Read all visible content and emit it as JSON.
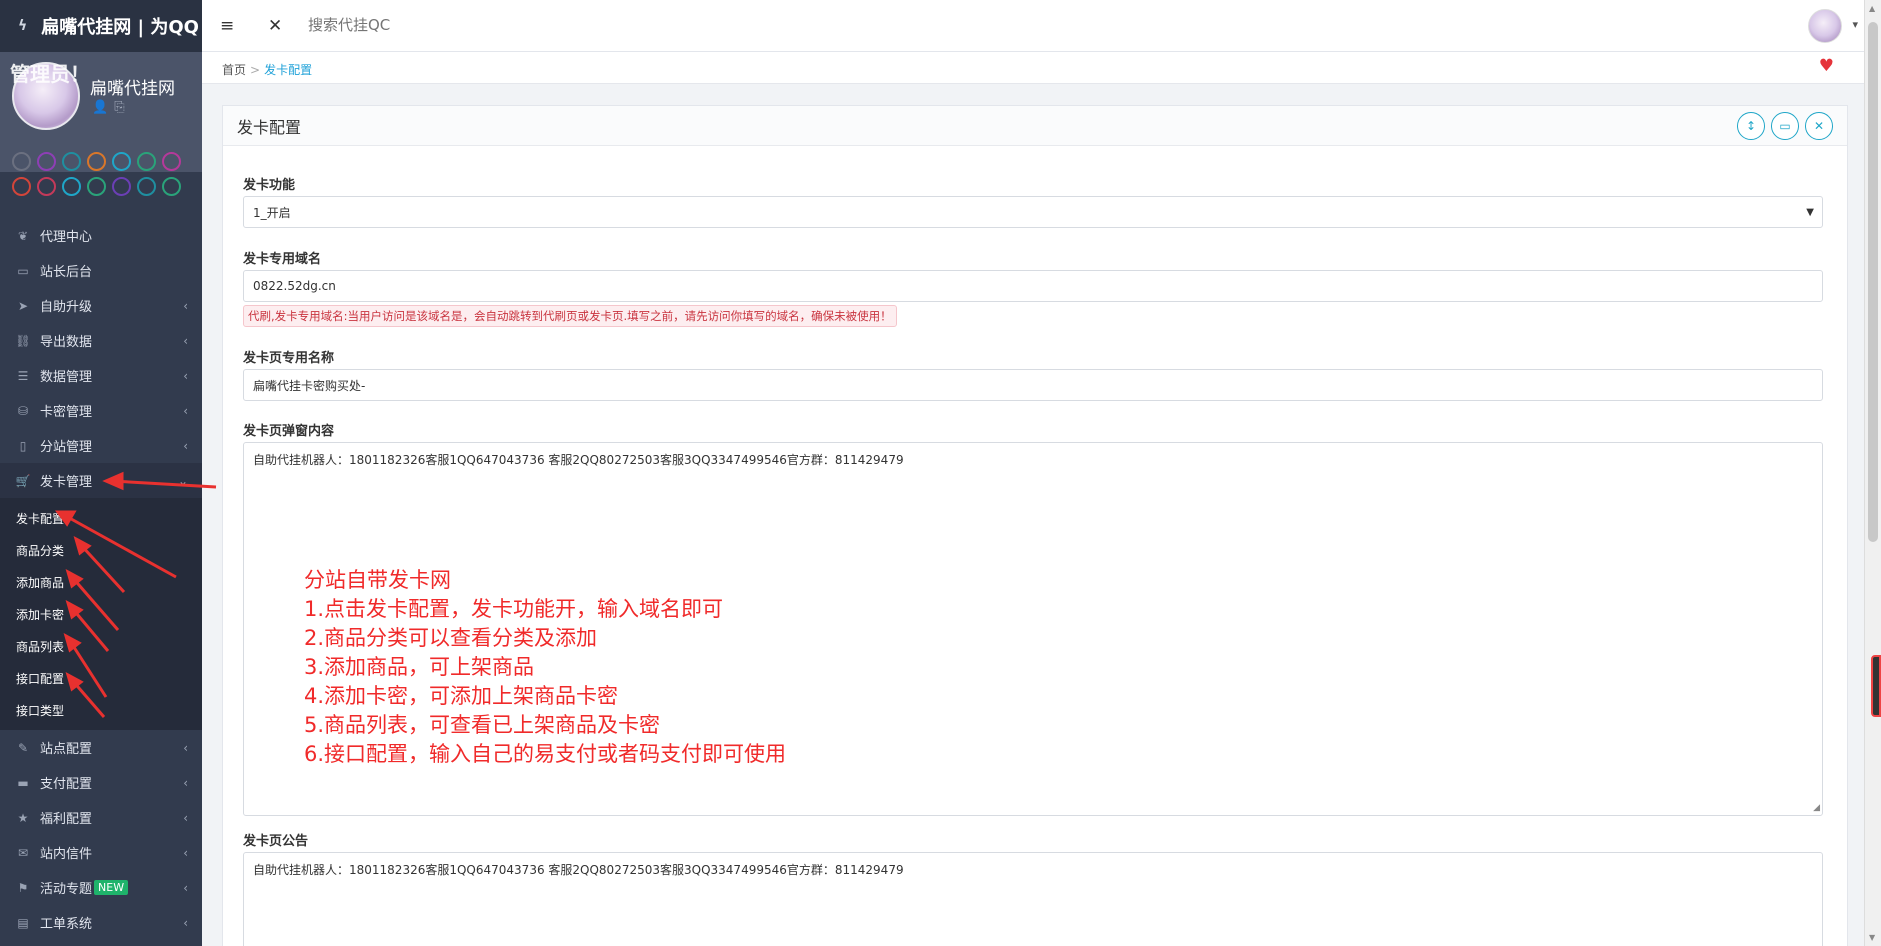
{
  "brand": {
    "title": "扁嘴代挂网 | 为QQ"
  },
  "profile": {
    "name": "扁嘴代挂网",
    "overlay_text": "管理员！"
  },
  "swatch_colors": [
    "#6b7080",
    "#8e3fb5",
    "#1f8fa0",
    "#d9772a",
    "#1fa6c8",
    "#2aa37a",
    "#b5399a",
    "#d2453a",
    "#c43a5a",
    "#1fa6c8",
    "#2aa37a",
    "#6b3fb5",
    "#1f8fa0",
    "#2aa37a"
  ],
  "nav": {
    "items": [
      {
        "label": "代理中心",
        "icon": "leaf-icon"
      },
      {
        "label": "站长后台",
        "icon": "laptop-icon"
      },
      {
        "label": "自助升级",
        "icon": "send-icon"
      },
      {
        "label": "导出数据",
        "icon": "share-icon"
      },
      {
        "label": "数据管理",
        "icon": "list-icon"
      },
      {
        "label": "卡密管理",
        "icon": "database-icon"
      },
      {
        "label": "分站管理",
        "icon": "mobile-icon"
      },
      {
        "label": "发卡管理",
        "icon": "cart-icon"
      }
    ],
    "sub_items": [
      "发卡配置",
      "商品分类",
      "添加商品",
      "添加卡密",
      "商品列表",
      "接口配置",
      "接口类型"
    ],
    "items_after": [
      {
        "label": "站点配置",
        "icon": "edit-icon"
      },
      {
        "label": "支付配置",
        "icon": "card-icon"
      },
      {
        "label": "福利配置",
        "icon": "star-icon"
      },
      {
        "label": "站内信件",
        "icon": "mail-icon"
      },
      {
        "label": "活动专题",
        "icon": "flag-icon",
        "badge": "NEW"
      },
      {
        "label": "工单系统",
        "icon": "file-icon"
      }
    ]
  },
  "header": {
    "search_placeholder": "搜索代挂QC"
  },
  "breadcrumb": {
    "home": "首页",
    "current": "发卡配置",
    "separator": ">"
  },
  "panel": {
    "title": "发卡配置",
    "fields": {
      "function": {
        "label": "发卡功能",
        "value": "1_开启"
      },
      "domain": {
        "label": "发卡专用域名",
        "value": "0822.52dg.cn",
        "hint": "代刷,发卡专用域名:当用户访问是该域名是，会自动跳转到代刷页或发卡页.填写之前，请先访问你填写的域名，确保未被使用！"
      },
      "page_name": {
        "label": "发卡页专用名称",
        "value": "扁嘴代挂卡密购买处-"
      },
      "popup": {
        "label": "发卡页弹窗内容",
        "value": "自助代挂机器人：1801182326客服1QQ647043736 客服2QQ80272503客服3QQ3347499546官方群：811429479"
      },
      "notice": {
        "label": "发卡页公告",
        "value": "自助代挂机器人：1801182326客服1QQ647043736 客服2QQ80272503客服3QQ3347499546官方群：811429479"
      }
    }
  },
  "annotation": {
    "lines": [
      "分站自带发卡网",
      "1.点击发卡配置，发卡功能开，输入域名即可",
      "2.商品分类可以查看分类及添加",
      "3.添加商品，可上架商品",
      "4.添加卡密，可添加上架商品卡密",
      "5.商品列表，可查看已上架商品及卡密",
      "6.接口配置，输入自己的易支付或者码支付即可使用"
    ]
  },
  "accent_colors": {
    "sidebar_bg": "#323b4e",
    "link": "#1fa1d8",
    "annotation": "#f02a2a",
    "tool_btn": "#1fa6c8",
    "badge": "#1fb36b"
  }
}
